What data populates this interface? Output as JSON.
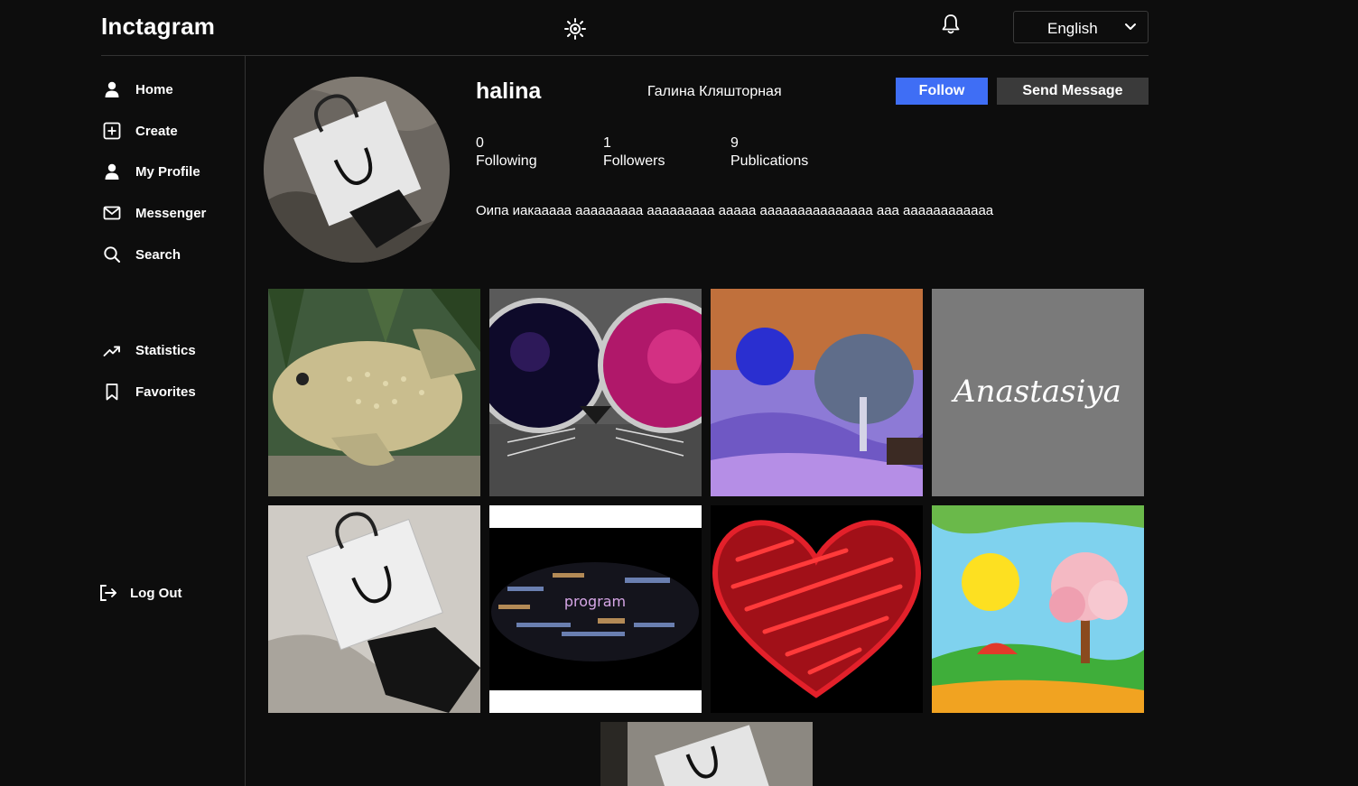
{
  "app": {
    "logo": "Inctagram",
    "language": "English"
  },
  "sidebar": {
    "items": [
      {
        "label": "Home",
        "icon": "person-icon"
      },
      {
        "label": "Create",
        "icon": "plus-square-icon"
      },
      {
        "label": "My Profile",
        "icon": "person-icon"
      },
      {
        "label": "Messenger",
        "icon": "mail-icon"
      },
      {
        "label": "Search",
        "icon": "search-icon"
      },
      {
        "label": "Statistics",
        "icon": "trending-up-icon"
      },
      {
        "label": "Favorites",
        "icon": "bookmark-icon"
      }
    ],
    "logout": {
      "label": "Log Out",
      "icon": "logout-icon"
    }
  },
  "profile": {
    "username": "halina",
    "full_name": "Галина Кляшторная",
    "follow_label": "Follow",
    "message_label": "Send Message",
    "stats": [
      {
        "count": "0",
        "label": "Following"
      },
      {
        "count": "1",
        "label": "Followers"
      },
      {
        "count": "9",
        "label": "Publications"
      }
    ],
    "bio": "Оипа иакааааа ааааааааа ааааааааа ааааа ааааааааааааааа ааа аааааааааааа"
  },
  "posts": [
    {
      "subject": "fish"
    },
    {
      "subject": "cat-with-sunglasses"
    },
    {
      "subject": "tree-landscape"
    },
    {
      "subject": "anastasiya-signature",
      "text": "Anastasiya"
    },
    {
      "subject": "chanel-bag"
    },
    {
      "subject": "word-cloud",
      "text": "program"
    },
    {
      "subject": "red-heart"
    },
    {
      "subject": "cartoon-landscape"
    },
    {
      "subject": "chanel-bag"
    }
  ],
  "colors": {
    "background": "#0d0d0d",
    "accent": "#3f6ef5",
    "secondary_button": "#3a3a3a",
    "divider": "#333333"
  }
}
